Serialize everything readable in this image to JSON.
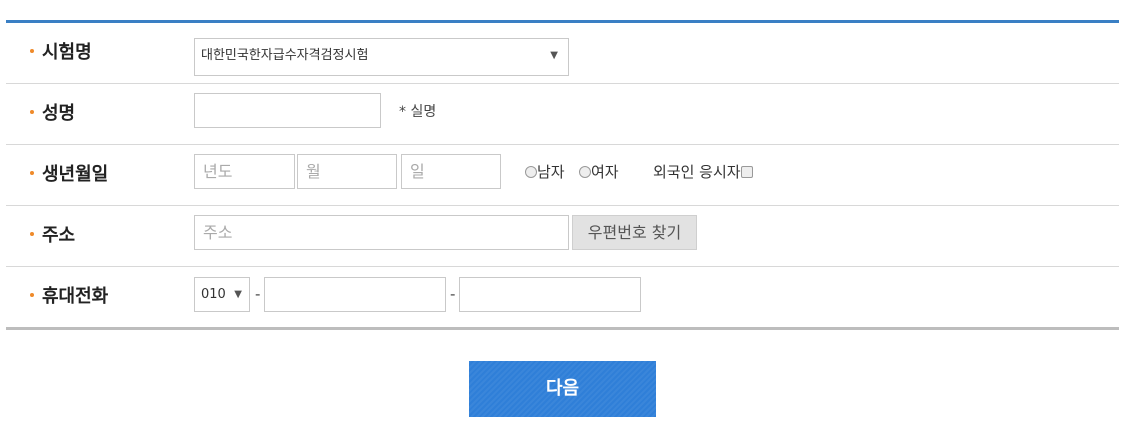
{
  "form": {
    "exam_name": {
      "label": "시험명",
      "selected": "대한민국한자급수자격검정시험",
      "arrow": "▼"
    },
    "name": {
      "label": "성명",
      "note": "* 실명"
    },
    "birth": {
      "label": "생년월일",
      "year_placeholder": "년도",
      "month_placeholder": "월",
      "day_placeholder": "일",
      "male": "남자",
      "female": "여자",
      "foreigner": "외국인 응시자"
    },
    "address": {
      "label": "주소",
      "placeholder": "주소",
      "zip_button": "우편번호 찾기"
    },
    "phone": {
      "label": "휴대전화",
      "prefix": "010",
      "arrow": "▼",
      "dash": "-"
    }
  },
  "next_button": "다음",
  "colors": {
    "accent": "#3a7fc4",
    "bullet": "#ef8a2a",
    "button": "#2f7fd8"
  }
}
